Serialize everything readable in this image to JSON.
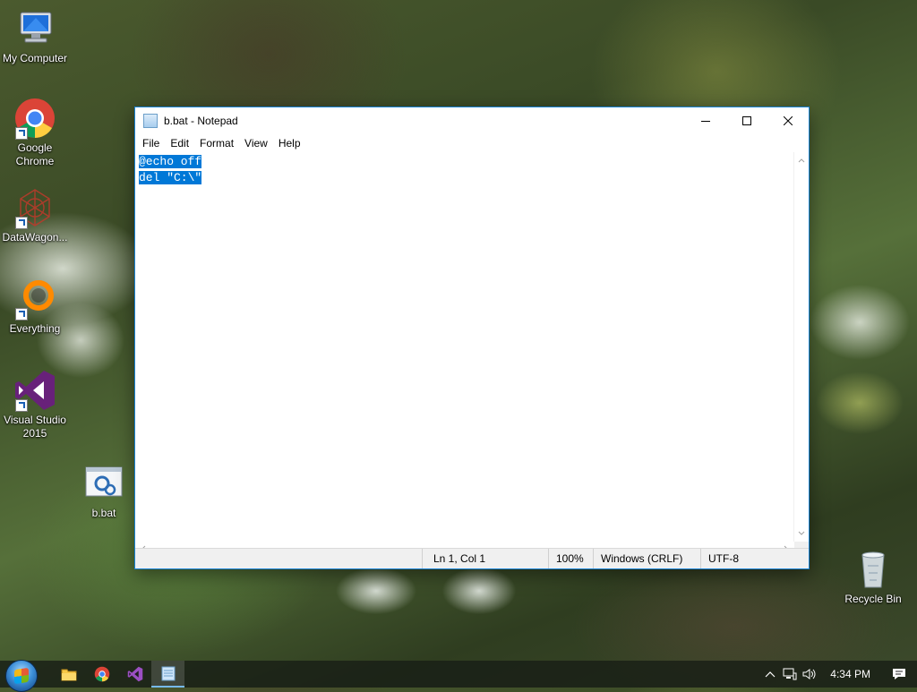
{
  "desktop": {
    "icons": [
      {
        "label": "My Computer"
      },
      {
        "label": "Google Chrome"
      },
      {
        "label": "DataWagon..."
      },
      {
        "label": "Everything"
      },
      {
        "label": "Visual Studio 2015"
      },
      {
        "label": "b.bat"
      },
      {
        "label": "Recycle Bin"
      }
    ]
  },
  "notepad": {
    "title": "b.bat - Notepad",
    "menu": [
      "File",
      "Edit",
      "Format",
      "View",
      "Help"
    ],
    "content": [
      "@echo off",
      "del \"C:\\\""
    ],
    "selection": "all",
    "status": {
      "position": "Ln 1, Col 1",
      "zoom": "100%",
      "line_ending": "Windows (CRLF)",
      "encoding": "UTF-8"
    }
  },
  "taskbar": {
    "pinned": [
      "file-explorer-icon",
      "chrome-icon",
      "visual-studio-icon",
      "notepad-icon"
    ],
    "active": "notepad-icon",
    "clock": "4:34 PM"
  },
  "colors": {
    "selection": "#0078d7",
    "window_border": "#1883d7"
  }
}
